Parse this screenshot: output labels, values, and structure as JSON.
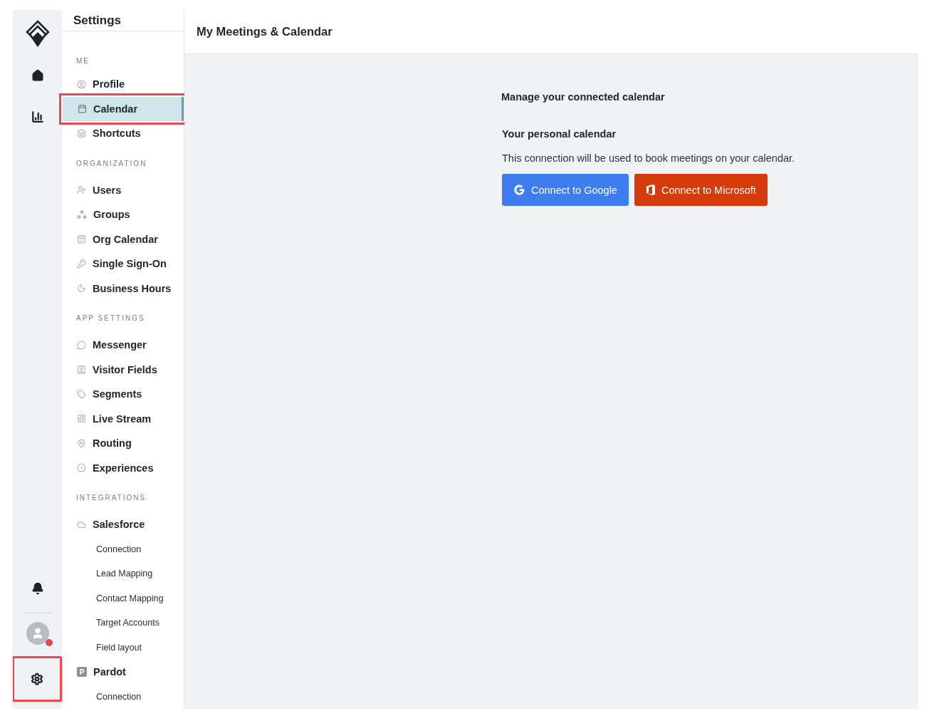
{
  "rail": {
    "items": [
      {
        "kind": "home"
      },
      {
        "kind": "reports"
      }
    ],
    "bottom": [
      {
        "kind": "notifications"
      },
      {
        "kind": "avatar",
        "unread": true
      },
      {
        "kind": "settings",
        "highlighted": true
      }
    ]
  },
  "sidebar": {
    "title": "Settings",
    "sections": [
      {
        "label": "ME",
        "items": [
          {
            "label": "Profile",
            "selected": false,
            "highlighted": false
          },
          {
            "label": "Calendar",
            "selected": true,
            "highlighted": true
          },
          {
            "label": "Shortcuts",
            "selected": false,
            "highlighted": false
          }
        ]
      },
      {
        "label": "ORGANIZATION",
        "items": [
          {
            "label": "Users",
            "selected": false,
            "highlighted": false
          },
          {
            "label": "Groups",
            "selected": false,
            "highlighted": false
          },
          {
            "label": "Org Calendar",
            "selected": false,
            "highlighted": false
          },
          {
            "label": "Single Sign-On",
            "selected": false,
            "highlighted": false
          },
          {
            "label": "Business Hours",
            "selected": false,
            "highlighted": false
          }
        ]
      },
      {
        "label": "APP SETTINGS",
        "items": [
          {
            "label": "Messenger",
            "selected": false,
            "highlighted": false
          },
          {
            "label": "Visitor Fields",
            "selected": false,
            "highlighted": false
          },
          {
            "label": "Segments",
            "selected": false,
            "highlighted": false
          },
          {
            "label": "Live Stream",
            "selected": false,
            "highlighted": false
          },
          {
            "label": "Routing",
            "selected": false,
            "highlighted": false
          },
          {
            "label": "Experiences",
            "selected": false,
            "highlighted": false
          }
        ]
      },
      {
        "label": "INTEGRATIONS",
        "items": [
          {
            "label": "Salesforce",
            "selected": false,
            "highlighted": false,
            "children": [
              {
                "label": "Connection",
                "selected": false
              },
              {
                "label": "Lead Mapping",
                "selected": false
              },
              {
                "label": "Contact Mapping",
                "selected": false
              },
              {
                "label": "Target Accounts",
                "selected": false
              },
              {
                "label": "Field layout",
                "selected": false
              }
            ]
          },
          {
            "label": "Pardot",
            "badge": "P",
            "selected": false,
            "highlighted": false,
            "children": [
              {
                "label": "Connection",
                "selected": false
              }
            ]
          }
        ]
      }
    ]
  },
  "page": {
    "title": "My Meetings & Calendar",
    "heading": "Manage your connected calendar",
    "subheading": "Your personal calendar",
    "description": "This connection will be used to book meetings on your calendar.",
    "buttons": [
      {
        "kind": "google",
        "label": "Connect to Google"
      },
      {
        "kind": "microsoft",
        "label": "Connect to Microsoft"
      }
    ]
  }
}
